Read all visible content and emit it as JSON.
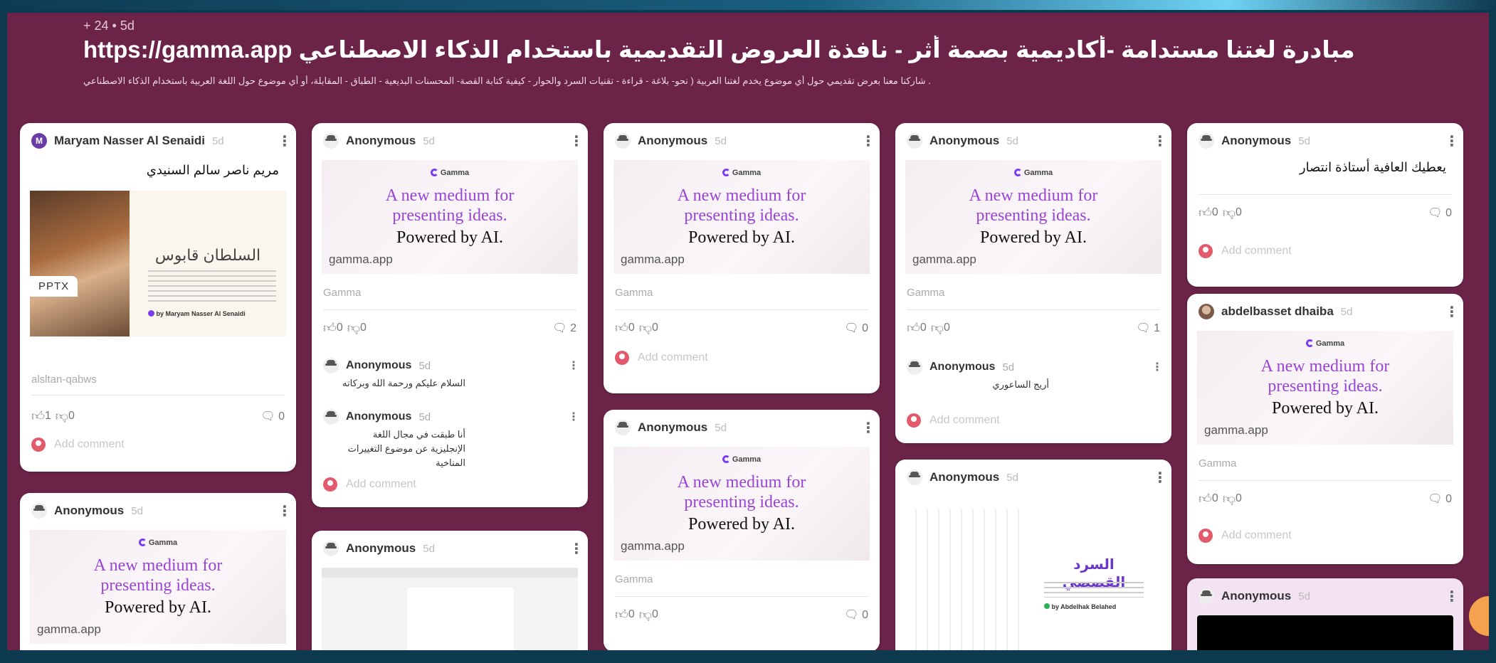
{
  "header": {
    "meta": "+ 24  • 5d",
    "title": "https://gamma.app مبادرة لغتنا مستدامة -أكاديمية بصمة أثر - نافذة العروض التقديمية باستخدام الذكاء الاصطناعي",
    "description": ". شاركنا معنا بعرض تقديمي حول أي موضوع يخدم لغتنا العربية ( نحو- بلاغة - قراءة - تقنيات السرد والحوار - كيفية كتابة القصة- المحسنات البديعية - الطباق - المقابلة، أو أي موضوع حول اللغة العربية باستخدام الذكاء الاصطناعي"
  },
  "gamma": {
    "logo": "Gamma",
    "line1": "A new medium for",
    "line2": "presenting ideas.",
    "line3": "Powered by AI.",
    "domain": "gamma.app",
    "source": "Gamma"
  },
  "common": {
    "anon": "Anonymous",
    "age": "5d",
    "add_comment": "Add comment",
    "zero": "0"
  },
  "cards": {
    "c1": {
      "author": "Maryam Nasser Al Senaidi",
      "text": "مريم ناصر سالم السنيدي",
      "slide_title": "السلطان قابوس",
      "slide_by": "by Maryam Nasser Al Senaidi",
      "badge": "PPTX",
      "source": "alsltan-qabws",
      "likes": "1",
      "dislikes": "0",
      "comments": "0"
    },
    "c2": {
      "comments": "2",
      "reply1": "السلام عليكم ورحمة الله وبركاته",
      "reply2": "أنا طبقت في مجال اللغة الإنجليزية عن موضوع التغييرات المناخية"
    },
    "c3": {
      "comments": "0"
    },
    "c4": {
      "comments": "1",
      "reply1": "أريج الساعوري"
    },
    "c5": {
      "text": "يعطيك العافية أستاذة انتصار",
      "comments": "0"
    },
    "c6": {
      "comments": "0"
    },
    "c7": {
      "slide_title": "السرد القصصي",
      "slide_by": "by Abdelhak Belahed"
    },
    "c8": {
      "author": "abdelbasset dhaiba",
      "comments": "0"
    }
  }
}
